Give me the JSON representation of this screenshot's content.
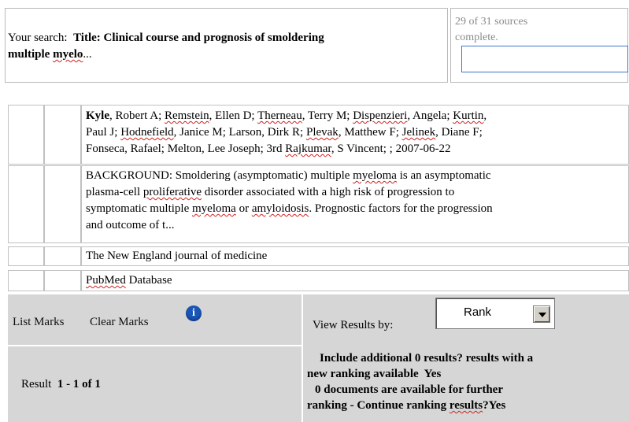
{
  "search": {
    "prefix": "Your search:",
    "title_label": "Title:",
    "query_part1": "Clinical course and prognosis of smoldering",
    "query_word1": "multiple",
    "query_word2": "myelo",
    "query_end": "..."
  },
  "status": {
    "progress_text": "29 of 31 sources complete.",
    "input_value": ""
  },
  "result": {
    "authors": {
      "a1_last": "Kyle",
      "a1_rest": ", Robert A; ",
      "a2_last": "Remstein",
      "a2_rest": ", Ellen D; ",
      "a3_last": "Therneau",
      "a3_rest": ", Terry M; ",
      "a4_last": "Dispenzieri",
      "a4_rest": ", Angela; ",
      "a5_last": "Kurtin",
      "a5_rest": ",",
      "line2_a": "Paul J; ",
      "a6_last": "Hodnefield",
      "a6_rest": ", Janice M; Larson, Dirk R; ",
      "a7_last": "Plevak",
      "a7_rest": ", Matthew F; ",
      "a8_last": "Jelinek",
      "a8_rest": ", Diane F;",
      "line3_a": "Fonseca, Rafael; Melton, Lee Joseph; 3rd ",
      "a9_last": "Rajkumar",
      "a9_rest": ", S Vincent; ; 2007-06-22"
    },
    "abstract": {
      "l1_a": "BACKGROUND: Smoldering (asymptomatic) multiple ",
      "l1_w": "myeloma",
      "l1_b": " is an asymptomatic",
      "l2_a": "plasma-cell ",
      "l2_w": "proliferative",
      "l2_b": " disorder associated with a high risk of progression to",
      "l3_a": "symptomatic multiple ",
      "l3_w": "myeloma",
      "l3_b": " or ",
      "l3_w2": "amyloidosis",
      "l3_c": ". Prognostic factors for the progression",
      "l4": "and outcome of t..."
    },
    "journal": "The New England journal of medicine",
    "source_word1": "PubMed",
    "source_word2": " Database"
  },
  "controls": {
    "list_marks": "List Marks",
    "clear_marks": "Clear Marks",
    "info_glyph": "i",
    "view_results_by": "View Results by:",
    "rank_selected": "Rank",
    "result_label": "Result",
    "result_range": "1 - 1 of 1",
    "include_line1": "Include additional 0 results? results with a",
    "include_line2": "new ranking available",
    "include_yes": "Yes",
    "docs_line1": "0 documents are available for further",
    "docs_line2_a": "ranking - Continue ranking ",
    "docs_line2_w": "results",
    "docs_yes": "?Yes"
  }
}
